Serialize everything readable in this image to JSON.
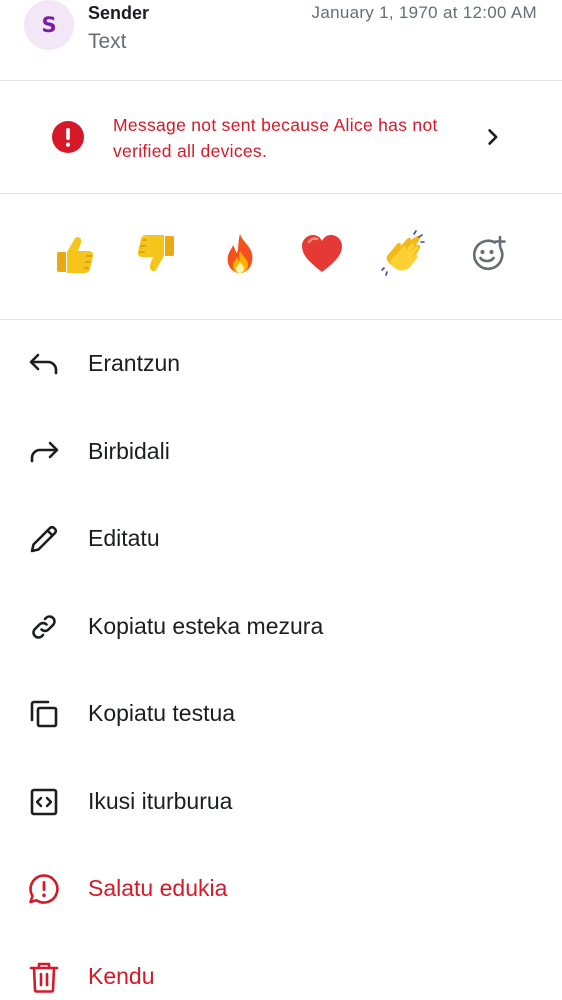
{
  "message": {
    "avatar_letter": "S",
    "sender": "Sender",
    "text": "Text",
    "timestamp": "January 1, 1970 at 12:00 AM"
  },
  "error_banner": {
    "text": "Message not sent because Alice has not verified all devices.",
    "icon": "error-icon",
    "chevron_icon": "chevron-right-icon",
    "color": "#d51928"
  },
  "reactions": [
    {
      "emoji": "👍",
      "name": "thumbs-up"
    },
    {
      "emoji": "👎",
      "name": "thumbs-down"
    },
    {
      "emoji": "🔥",
      "name": "fire"
    },
    {
      "emoji": "❤️",
      "name": "red-heart"
    },
    {
      "emoji": "👏",
      "name": "clapping-hands"
    },
    {
      "emoji": "",
      "name": "add-reaction",
      "icon": "add-reaction-icon"
    }
  ],
  "actions": [
    {
      "label": "Erantzun",
      "icon": "reply-icon",
      "danger": false
    },
    {
      "label": "Birbidali",
      "icon": "forward-icon",
      "danger": false
    },
    {
      "label": "Editatu",
      "icon": "edit-pencil-icon",
      "danger": false
    },
    {
      "label": "Kopiatu esteka mezura",
      "icon": "link-icon",
      "danger": false
    },
    {
      "label": "Kopiatu testua",
      "icon": "copy-icon",
      "danger": false
    },
    {
      "label": "Ikusi iturburua",
      "icon": "view-source-icon",
      "danger": false
    },
    {
      "label": "Salatu edukia",
      "icon": "report-icon",
      "danger": true
    },
    {
      "label": "Kendu",
      "icon": "delete-icon",
      "danger": true
    }
  ],
  "colors": {
    "text_primary": "#1b1d22",
    "text_secondary": "#656d77",
    "critical": "#d51928",
    "divider": "#e1e3e7",
    "avatar_bg": "#f3e6f7",
    "avatar_fg": "#7b1fa2"
  }
}
